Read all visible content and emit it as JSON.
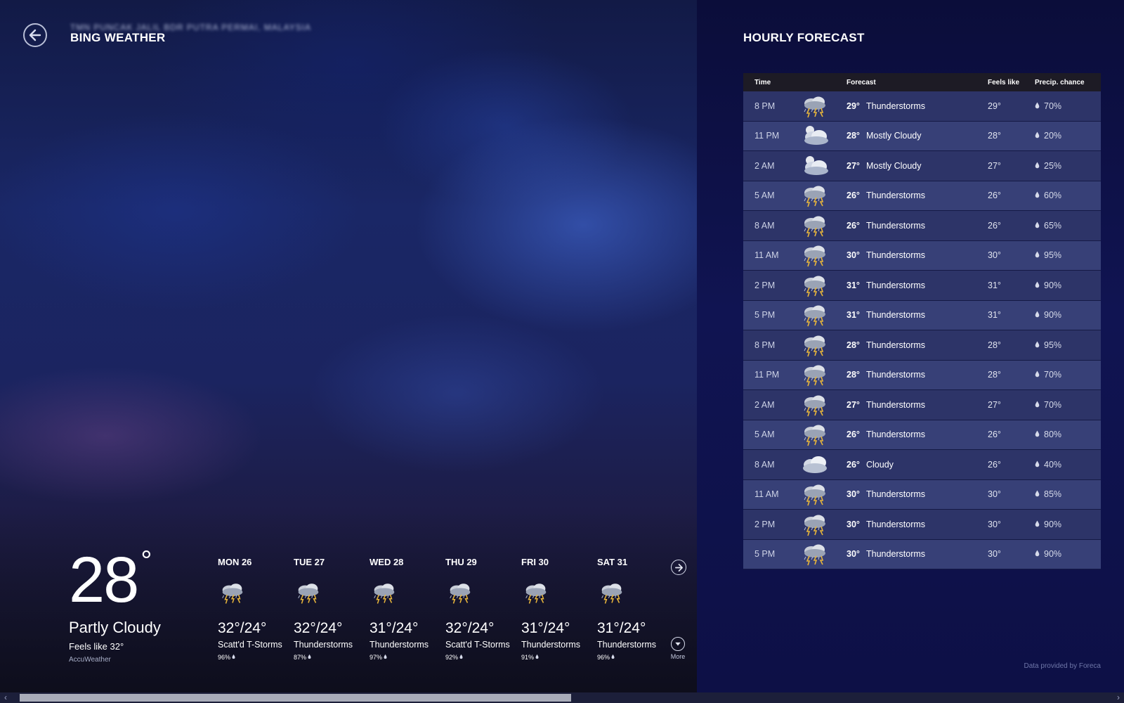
{
  "app": {
    "title": "BING WEATHER",
    "location": "TMN PUNCAK JALIL BDR PUTRA PERMAI, MALAYSIA"
  },
  "current": {
    "temp": "28",
    "degree": "°",
    "condition": "Partly Cloudy",
    "feels_like": "Feels like 32°",
    "provider": "AccuWeather"
  },
  "daily": [
    {
      "day": "MON 26",
      "temps": "32°/24°",
      "condition": "Scatt'd T-Storms",
      "precip": "96%",
      "icon": "thunderstorm-icon"
    },
    {
      "day": "TUE 27",
      "temps": "32°/24°",
      "condition": "Thunderstorms",
      "precip": "87%",
      "icon": "thunderstorm-icon"
    },
    {
      "day": "WED 28",
      "temps": "31°/24°",
      "condition": "Thunderstorms",
      "precip": "97%",
      "icon": "thunderstorm-icon"
    },
    {
      "day": "THU 29",
      "temps": "32°/24°",
      "condition": "Scatt'd T-Storms",
      "precip": "92%",
      "icon": "thunderstorm-icon"
    },
    {
      "day": "FRI 30",
      "temps": "31°/24°",
      "condition": "Thunderstorms",
      "precip": "91%",
      "icon": "thunderstorm-icon"
    },
    {
      "day": "SAT 31",
      "temps": "31°/24°",
      "condition": "Thunderstorms",
      "precip": "96%",
      "icon": "thunderstorm-icon"
    }
  ],
  "more_label": "More",
  "hourly": {
    "title": "HOURLY FORECAST",
    "columns": {
      "time": "Time",
      "forecast": "Forecast",
      "feels": "Feels like",
      "precip": "Precip. chance"
    },
    "rows": [
      {
        "time": "8 PM",
        "temp": "29°",
        "condition": "Thunderstorms",
        "feels": "29°",
        "precip": "70%",
        "icon": "thunderstorm-icon"
      },
      {
        "time": "11 PM",
        "temp": "28°",
        "condition": "Mostly Cloudy",
        "feels": "28°",
        "precip": "20%",
        "icon": "mostly-cloudy-night-icon"
      },
      {
        "time": "2 AM",
        "temp": "27°",
        "condition": "Mostly Cloudy",
        "feels": "27°",
        "precip": "25%",
        "icon": "mostly-cloudy-night-icon"
      },
      {
        "time": "5 AM",
        "temp": "26°",
        "condition": "Thunderstorms",
        "feels": "26°",
        "precip": "60%",
        "icon": "thunderstorm-icon"
      },
      {
        "time": "8 AM",
        "temp": "26°",
        "condition": "Thunderstorms",
        "feels": "26°",
        "precip": "65%",
        "icon": "thunderstorm-icon"
      },
      {
        "time": "11 AM",
        "temp": "30°",
        "condition": "Thunderstorms",
        "feels": "30°",
        "precip": "95%",
        "icon": "thunderstorm-icon"
      },
      {
        "time": "2 PM",
        "temp": "31°",
        "condition": "Thunderstorms",
        "feels": "31°",
        "precip": "90%",
        "icon": "thunderstorm-icon"
      },
      {
        "time": "5 PM",
        "temp": "31°",
        "condition": "Thunderstorms",
        "feels": "31°",
        "precip": "90%",
        "icon": "thunderstorm-icon"
      },
      {
        "time": "8 PM",
        "temp": "28°",
        "condition": "Thunderstorms",
        "feels": "28°",
        "precip": "95%",
        "icon": "thunderstorm-icon"
      },
      {
        "time": "11 PM",
        "temp": "28°",
        "condition": "Thunderstorms",
        "feels": "28°",
        "precip": "70%",
        "icon": "thunderstorm-icon"
      },
      {
        "time": "2 AM",
        "temp": "27°",
        "condition": "Thunderstorms",
        "feels": "27°",
        "precip": "70%",
        "icon": "thunderstorm-icon"
      },
      {
        "time": "5 AM",
        "temp": "26°",
        "condition": "Thunderstorms",
        "feels": "26°",
        "precip": "80%",
        "icon": "thunderstorm-icon"
      },
      {
        "time": "8 AM",
        "temp": "26°",
        "condition": "Cloudy",
        "feels": "26°",
        "precip": "40%",
        "icon": "cloudy-icon"
      },
      {
        "time": "11 AM",
        "temp": "30°",
        "condition": "Thunderstorms",
        "feels": "30°",
        "precip": "85%",
        "icon": "thunderstorm-icon"
      },
      {
        "time": "2 PM",
        "temp": "30°",
        "condition": "Thunderstorms",
        "feels": "30°",
        "precip": "90%",
        "icon": "thunderstorm-icon"
      },
      {
        "time": "5 PM",
        "temp": "30°",
        "condition": "Thunderstorms",
        "feels": "30°",
        "precip": "90%",
        "icon": "thunderstorm-icon"
      }
    ]
  },
  "credit": "Data provided by Foreca",
  "colors": {
    "panel_bg": "#101452",
    "row_odd": "#2d3468",
    "row_even": "#374077",
    "header_row": "#1d1b25",
    "bolt": "#e8b63b"
  },
  "scroll": {
    "position": 0.0
  }
}
